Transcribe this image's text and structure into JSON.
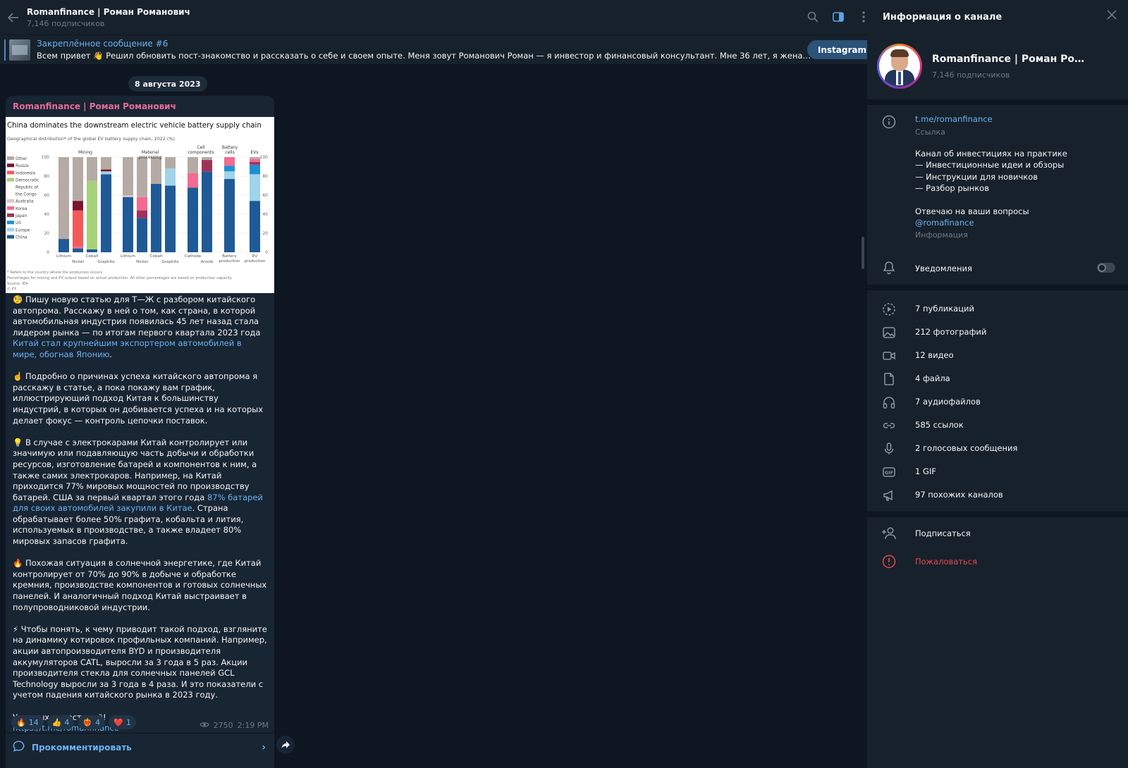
{
  "header": {
    "channel_name": "Romanfinance | Роман Романович",
    "subscribers": "7,146 подписчиков"
  },
  "pinned": {
    "title": "Закреплённое сообщение #6",
    "text": "Всем привет 👋 Решил обновить пост-знакомство и рассказать о себе и своем опыте.  Меня зовут Романович Роман — я инвестор и финансовый консультант. Мне 36 лет, я женат, воспитываю сы...",
    "button": "Instagram"
  },
  "date_pill": "8 августа 2023",
  "post": {
    "author": "Romanfinance | Роман Романович",
    "p1_a": "🧐 Пишу новую статью для Т—Ж с разбором китайского автопрома. Расскажу в ней о том, как страна, в которой автомобильная индустрия появилась 45 лет назад стала лидером рынка — по итогам первого квартала 2023 года ",
    "p1_link": "Китай стал крупнейшим экспортером автомобилей в мире, обогнав Японию",
    "p1_b": ".",
    "p2": "☝️ Подробно о причинах успеха китайского автопрома я расскажу в статье, а пока покажу вам график, иллюстрирующий подход Китая к большинству индустрий, в которых он добивается успеха и на которых делает фокус — контроль цепочки поставок.",
    "p3_a": "💡 В случае с электрокарами Китай контролирует или значимую или подавляющую часть добычи и обработки ресурсов, изготовление батарей и компонентов к ним, а также самих электрокаров. Например, на Китай приходится 77% мировых мощностей по производству батарей. США за первый квартал этого года ",
    "p3_link": "87% батарей для своих автомобилей закупили в Китае",
    "p3_b": ". Страна обрабатывает более 50% графита, кобальта и лития, используемых в производстве, а также владеет 80% мировых запасов графита.",
    "p4": "🔥 Похожая ситуация в солнечной энергетике, где Китай контролирует от 70% до 90% в добыче и обработке кремния, производстве компонентов и готовых солнечных панелей. И аналогичный подход Китай выстраивает в полупроводниковой индустрии.",
    "p5": "⚡ Чтобы понять, к чему приводит такой подход, взгляните на динамику котировок профильных компаний. Например, акции автопроизводителя BYD и производителя аккумуляторов CATL, выросли за 3 года в 5 раз. Акции производителя стекла для солнечных панелей GCL Technology выросли за 3 года в 4 раза. И это показатели с учетом падения китайского рынка в 2023 году.",
    "p6": "Удачных инвестиций!",
    "p6_link": "https://t.me/romanfinance",
    "reactions": [
      {
        "emoji": "🔥",
        "count": "14"
      },
      {
        "emoji": "👍",
        "count": "4"
      },
      {
        "emoji": "❤️‍🔥",
        "count": "4"
      },
      {
        "emoji": "❤️",
        "count": "1"
      }
    ],
    "views": "2750",
    "time": "2:19 PM",
    "comment_label": "Прокомментировать"
  },
  "chart_data": {
    "type": "bar",
    "title": "China dominates the downstream electric vehicle battery supply chain",
    "subtitle": "Geographical distribution* of the global EV battery supply chain, 2022 (%)",
    "footnote1": "* Refers to the country where the production occurs",
    "footnote2": "Percentages for mining and EV output based on actual production. All other percentages are based on production capacity",
    "footnote3": "Source: IEA",
    "footnote4": "© FT",
    "groups": [
      "Mining",
      "Material processing",
      "Cell components",
      "Battery cells",
      "EVs"
    ],
    "categories": [
      "Lithium",
      "Nickel",
      "Cobalt",
      "Graphite",
      "Lithium",
      "Nickel",
      "Cobalt",
      "Graphite",
      "Cathode",
      "Anode",
      "Battery production",
      "EV production"
    ],
    "ylim": [
      0,
      100
    ],
    "yticks": [
      "0",
      "20",
      "40",
      "60",
      "80",
      "100"
    ],
    "series": [
      {
        "name": "China",
        "color": "#1f5a96",
        "values": [
          14,
          4,
          3,
          82,
          58,
          36,
          72,
          70,
          68,
          85,
          77,
          54
        ]
      },
      {
        "name": "Europe",
        "color": "#9fd4ea",
        "values": [
          0,
          0,
          0,
          3,
          0,
          0,
          0,
          18,
          0,
          0,
          8,
          28
        ]
      },
      {
        "name": "US",
        "color": "#1f8fd2",
        "values": [
          0,
          0,
          0,
          0,
          0,
          0,
          0,
          0,
          0,
          0,
          6,
          10
        ]
      },
      {
        "name": "Japan",
        "color": "#a0325a",
        "values": [
          0,
          0,
          0,
          0,
          0,
          8,
          0,
          0,
          0,
          12,
          0,
          3
        ]
      },
      {
        "name": "Korea",
        "color": "#f46a90",
        "values": [
          0,
          2,
          0,
          0,
          0,
          14,
          0,
          0,
          15,
          0,
          9,
          3
        ]
      },
      {
        "name": "Australia",
        "color": "#d8c8c4",
        "values": [
          0,
          0,
          0,
          0,
          2,
          0,
          0,
          0,
          0,
          0,
          0,
          0
        ]
      },
      {
        "name": "Democratic Republic of the Congo",
        "color": "#a6d27a",
        "values": [
          0,
          0,
          72,
          0,
          0,
          0,
          0,
          0,
          0,
          0,
          0,
          0
        ]
      },
      {
        "name": "Indonesia",
        "color": "#f25a5a",
        "values": [
          0,
          38,
          0,
          0,
          0,
          0,
          0,
          0,
          0,
          0,
          0,
          0
        ]
      },
      {
        "name": "Russia",
        "color": "#7a1430",
        "values": [
          0,
          10,
          0,
          2,
          0,
          0,
          0,
          0,
          0,
          0,
          0,
          0
        ]
      },
      {
        "name": "Other",
        "color": "#b5aba4",
        "values": [
          86,
          46,
          25,
          13,
          40,
          42,
          28,
          12,
          17,
          3,
          0,
          2
        ]
      }
    ]
  },
  "sidebar": {
    "title": "Информация о канале",
    "channel_name": "Romanfinance | Роман Романович",
    "subscribers": "7,146 подписчиков",
    "link": "t.me/romanfinance",
    "link_caption": "Ссылка",
    "desc1": "Канал об инвестициях на практике",
    "desc2": "— Инвестиционные идеи и обзоры",
    "desc3": "— Инструкции для новичков",
    "desc4": "— Разбор рынков",
    "desc5": "Отвечаю на ваши вопросы",
    "username": "@romafinance",
    "info_caption": "Информация",
    "notifications": "Уведомления",
    "media": [
      {
        "icon": "video-play-icon",
        "label": "7 публикаций"
      },
      {
        "icon": "photo-icon",
        "label": "212 фотографий"
      },
      {
        "icon": "video-camera-icon",
        "label": "12 видео"
      },
      {
        "icon": "file-icon",
        "label": "4 файла"
      },
      {
        "icon": "headphones-icon",
        "label": "7 аудиофайлов"
      },
      {
        "icon": "link-icon",
        "label": "585 ссылок"
      },
      {
        "icon": "microphone-icon",
        "label": "2 голосовых сообщения"
      },
      {
        "icon": "gif-icon",
        "label": "1 GIF"
      },
      {
        "icon": "megaphone-icon",
        "label": "97 похожих каналов"
      }
    ],
    "subscribe": "Подписаться",
    "report": "Пожаловаться"
  }
}
